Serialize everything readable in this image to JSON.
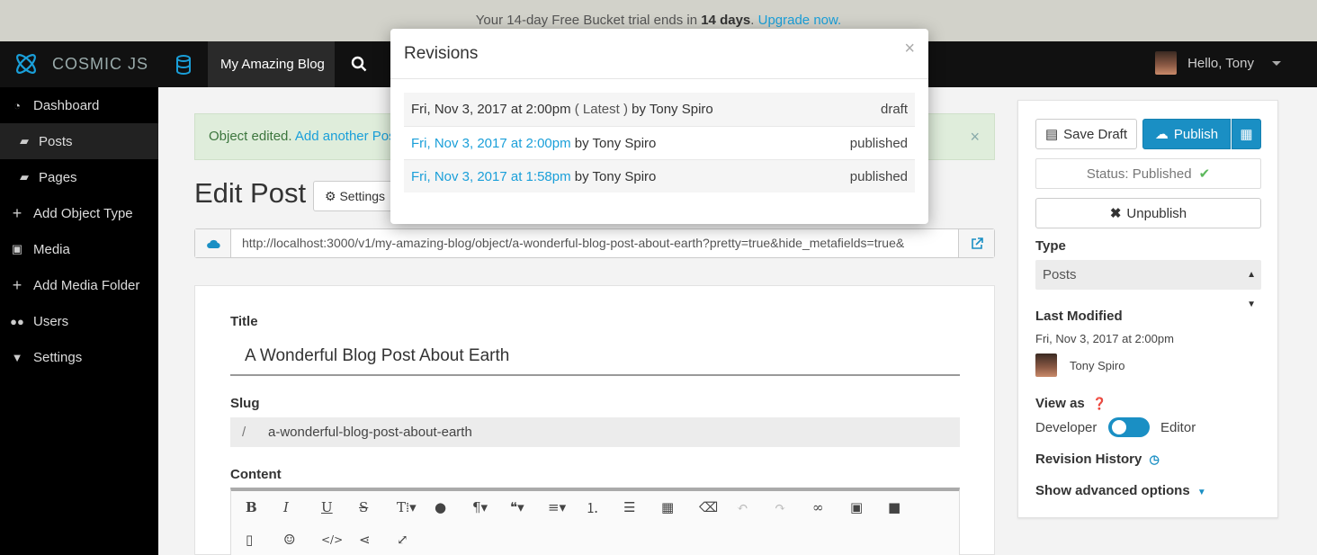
{
  "banner": {
    "prefix": "Your 14-day Free Bucket trial ends in",
    "days": "14 days",
    "period": ".",
    "upgrade_link": "Upgrade now."
  },
  "topbar": {
    "logo_text": "COSMIC JS",
    "bucket_name": "My Amazing Blog",
    "greeting": "Hello, Tony"
  },
  "sidebar": {
    "items": [
      {
        "label": "Dashboard",
        "icon": "dashboard-icon"
      },
      {
        "label": "Posts",
        "icon": "folder-icon",
        "active": true
      },
      {
        "label": "Pages",
        "icon": "folder-icon"
      },
      {
        "label": "Add Object Type",
        "icon": "plus-icon"
      },
      {
        "label": "Media",
        "icon": "image-icon"
      },
      {
        "label": "Add Media Folder",
        "icon": "plus-icon"
      },
      {
        "label": "Users",
        "icon": "users-icon"
      },
      {
        "label": "Settings",
        "icon": "caret-down-icon"
      }
    ]
  },
  "alert": {
    "text": "Object edited.",
    "link": "Add another Pos"
  },
  "main": {
    "heading": "Edit Post",
    "settings_label": "Settings",
    "url": "http://localhost:3000/v1/my-amazing-blog/object/a-wonderful-blog-post-about-earth?pretty=true&hide_metafields=true&",
    "title_label": "Title",
    "title_value": "A Wonderful Blog Post About Earth",
    "slug_label": "Slug",
    "slug_prefix": "/",
    "slug_value": "a-wonderful-blog-post-about-earth",
    "content_label": "Content"
  },
  "right_panel": {
    "save_draft": "Save Draft",
    "publish": "Publish",
    "status": "Status: Published",
    "unpublish": "Unpublish",
    "type_label": "Type",
    "type_value": "Posts",
    "last_modified_label": "Last Modified",
    "last_modified_value": "Fri, Nov 3, 2017 at 2:00pm",
    "modified_by": "Tony Spiro",
    "view_as_label": "View as",
    "developer": "Developer",
    "editor": "Editor",
    "revision_history": "Revision History",
    "advanced": "Show advanced options"
  },
  "modal": {
    "title": "Revisions",
    "close": "×",
    "revisions": [
      {
        "date": "Fri, Nov 3, 2017 at 2:00pm",
        "tag": "( Latest )",
        "by": "by",
        "author": "Tony Spiro",
        "status": "draft",
        "link": false
      },
      {
        "date": "Fri, Nov 3, 2017 at 2:00pm",
        "tag": "",
        "by": "by",
        "author": "Tony Spiro",
        "status": "published",
        "link": true
      },
      {
        "date": "Fri, Nov 3, 2017 at 1:58pm",
        "tag": "",
        "by": "by",
        "author": "Tony Spiro",
        "status": "published",
        "link": true
      }
    ]
  },
  "colors": {
    "accent": "#1a8fc4",
    "link": "#1a9fd9",
    "sidebar_bg": "#000000",
    "banner_bg": "#d2d2ca",
    "alert_bg": "#dfeddb"
  }
}
